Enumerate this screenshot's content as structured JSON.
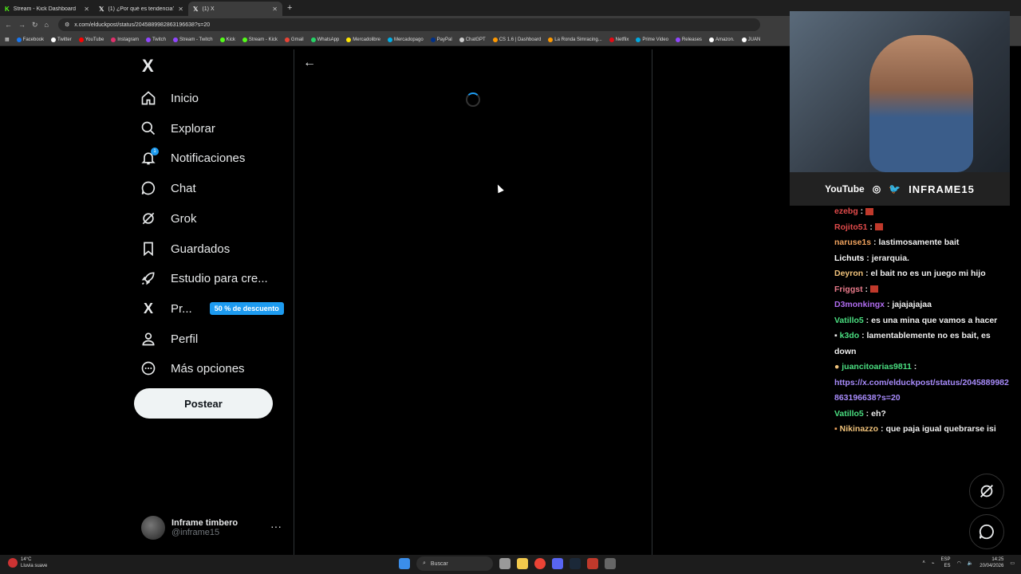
{
  "browser": {
    "tabs": [
      {
        "label": "Stream - Kick Dashboard",
        "icon": "kick-icon",
        "active": false
      },
      {
        "label": "(1) ¿Por qué es tendencia? @j",
        "icon": "x-icon",
        "active": false
      },
      {
        "label": "(1) X",
        "icon": "x-icon",
        "active": true
      }
    ],
    "url": "x.com/elduckpost/status/2045889982863196638?s=20",
    "bookmarks": [
      "Facebook",
      "Twitter",
      "YouTube",
      "Instagram",
      "Twitch",
      "Stream - Twitch",
      "Kick",
      "Stream - Kick",
      "Gmail",
      "WhatsApp",
      "Mercadolibre",
      "Mercadopago",
      "PayPal",
      "ChatGPT",
      "CS 1.6 | Dashboard",
      "La Ronda Simracing...",
      "Netflix",
      "Prime Video",
      "Releases",
      "Amazon.",
      "JUAN"
    ]
  },
  "sidebar": {
    "logo": "X",
    "items": [
      {
        "label": "Inicio",
        "icon": "home-icon"
      },
      {
        "label": "Explorar",
        "icon": "search-icon"
      },
      {
        "label": "Notificaciones",
        "icon": "bell-icon",
        "badge": "1"
      },
      {
        "label": "Chat",
        "icon": "chat-icon"
      },
      {
        "label": "Grok",
        "icon": "grok-icon"
      },
      {
        "label": "Guardados",
        "icon": "bookmark-icon"
      },
      {
        "label": "Estudio para cre...",
        "icon": "rocket-icon"
      },
      {
        "label": "Pr...",
        "icon": "x-premium-icon",
        "promo": "50 % de descuento"
      },
      {
        "label": "Perfil",
        "icon": "person-icon"
      },
      {
        "label": "Más opciones",
        "icon": "more-circle-icon"
      }
    ],
    "post_label": "Postear",
    "profile": {
      "name": "Inframe timbero",
      "handle": "@inframe15"
    }
  },
  "webcam": {
    "labels": [
      "YouTube",
      "INFRAME15"
    ]
  },
  "chat": [
    {
      "user": "ezebg",
      "color": "#e04a4a",
      "text": "",
      "emote": true
    },
    {
      "user": "Rojito51",
      "color": "#e04a4a",
      "text": "",
      "emote": true
    },
    {
      "user": "naruse1s",
      "color": "#f0a35e",
      "text": "lastimosamente bait"
    },
    {
      "user": "Lichuts",
      "color": "#ffffff",
      "text": "jerarquia."
    },
    {
      "user": "Deyron",
      "color": "#f0c27a",
      "text": "el bait no es un juego mi hijo"
    },
    {
      "user": "Friggst",
      "color": "#e87a8a",
      "text": "",
      "emote": true
    },
    {
      "user": "D3monkingx",
      "color": "#b06cf0",
      "text": "jajajajajaa"
    },
    {
      "user": "Vatillo5",
      "color": "#4ade80",
      "text": "es una mina que vamos a hacer"
    },
    {
      "user": "k3do",
      "color": "#4ade80",
      "text": "lamentablemente no es bait, es down"
    },
    {
      "user": "juancitoarias9811",
      "color": "#4ade80",
      "text": "",
      "link": "https://x.com/elduckpost/status/2045889982863196638?s=20"
    },
    {
      "user": "Vatillo5",
      "color": "#4ade80",
      "text": "eh?"
    },
    {
      "user": "Nikinazzo",
      "color": "#f0c27a",
      "text": "que paja igual quebrarse isi"
    }
  ],
  "taskbar": {
    "weather_temp": "14°C",
    "weather_desc": "Lluvia suave",
    "search_placeholder": "Buscar",
    "lang": "ESP",
    "lang_sub": "ES",
    "time": "14:25",
    "date": "20/04/2026"
  }
}
